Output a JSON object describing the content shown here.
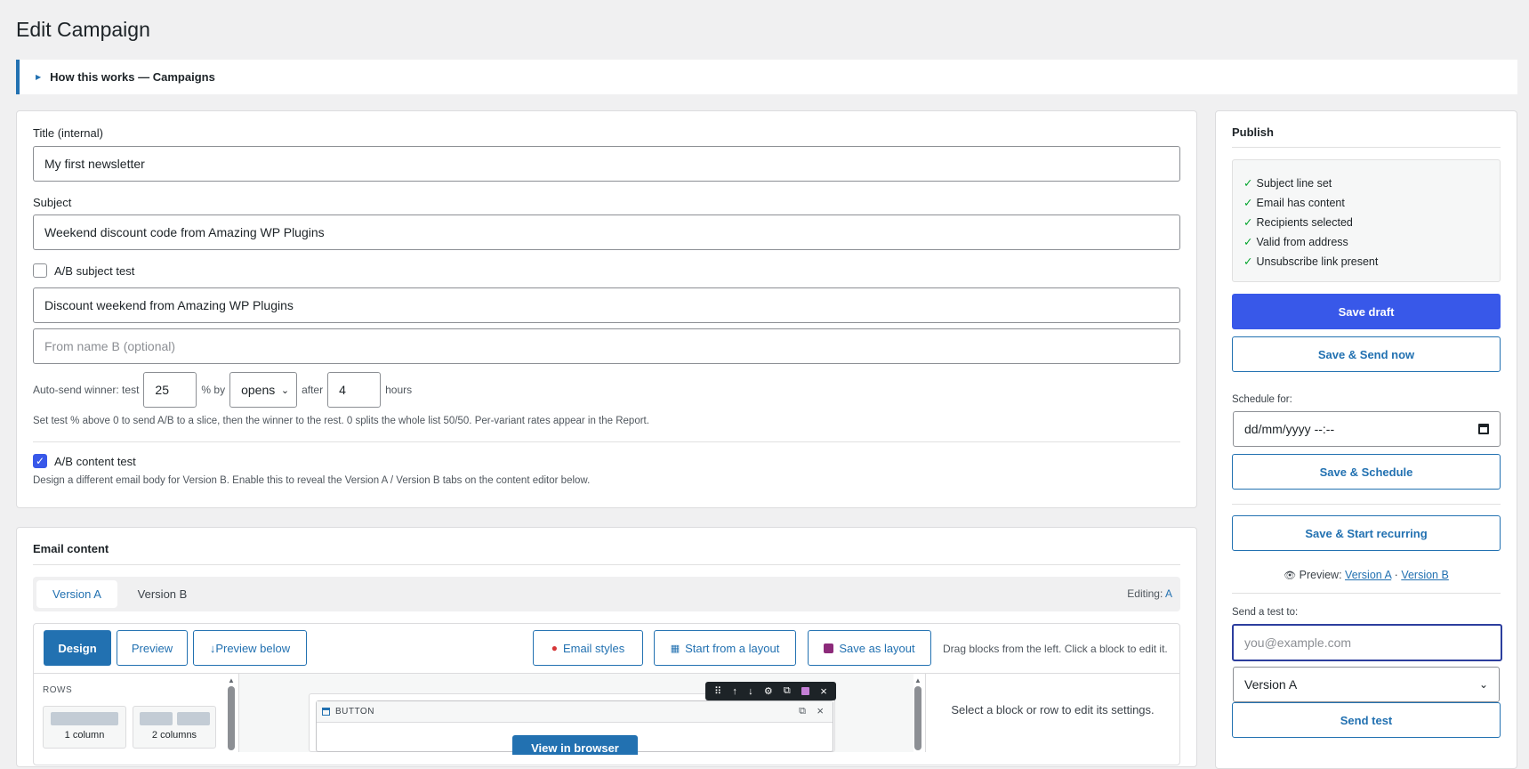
{
  "page_title": "Edit Campaign",
  "help": {
    "label": "How this works — Campaigns"
  },
  "form": {
    "title_label": "Title (internal)",
    "title_value": "My first newsletter",
    "subject_label": "Subject",
    "subject_value": "Weekend discount code from Amazing WP Plugins",
    "ab_subject_label": "A/B subject test",
    "subject_b_value": "Discount weekend from Amazing WP Plugins",
    "from_name_b_placeholder": "From name B (optional)",
    "autosend_prefix": "Auto-send winner: test",
    "autosend_percent": "25",
    "autosend_by": "% by",
    "autosend_metric": "opens",
    "autosend_after": "after",
    "autosend_hours_value": "4",
    "autosend_hours": "hours",
    "autosend_help": "Set test % above 0 to send A/B to a slice, then the winner to the rest. 0 splits the whole list 50/50. Per-variant rates appear in the Report.",
    "ab_content_label": "A/B content test",
    "ab_content_help": "Design a different email body for Version B. Enable this to reveal the Version A / Version B tabs on the content editor below."
  },
  "email_content": {
    "heading": "Email content",
    "tabs": [
      "Version A",
      "Version B"
    ],
    "editing_label": "Editing:",
    "editing_value": "A",
    "toolbar": {
      "design": "Design",
      "preview": "Preview",
      "preview_below": "↓Preview below",
      "email_styles": "Email styles",
      "start_layout": "Start from a layout",
      "save_layout": "Save as layout",
      "hint": "Drag blocks from the left. Click a block to edit it."
    },
    "rows_heading": "ROWS",
    "row_options": [
      "1 column",
      "2 columns"
    ],
    "block_label": "BUTTON",
    "button_text": "View in browser",
    "settings_hint": "Select a block or row to edit its settings."
  },
  "publish": {
    "heading": "Publish",
    "checklist": [
      "Subject line set",
      "Email has content",
      "Recipients selected",
      "Valid from address",
      "Unsubscribe link present"
    ],
    "save_draft": "Save draft",
    "save_send": "Save & Send now",
    "schedule_label": "Schedule for:",
    "schedule_placeholder": "dd/mm/yyyy --:--",
    "save_schedule": "Save & Schedule",
    "save_recurring": "Save & Start recurring",
    "preview_label": "Preview:",
    "preview_a": "Version A",
    "preview_sep": "·",
    "preview_b": "Version B",
    "send_test_label": "Send a test to:",
    "send_test_placeholder": "you@example.com",
    "send_test_version": "Version A",
    "send_test_button": "Send test"
  },
  "colors": {
    "accent": "#3858e9",
    "link": "#2271b1",
    "design_btn": "#2271b1",
    "check": "#00a32a"
  }
}
